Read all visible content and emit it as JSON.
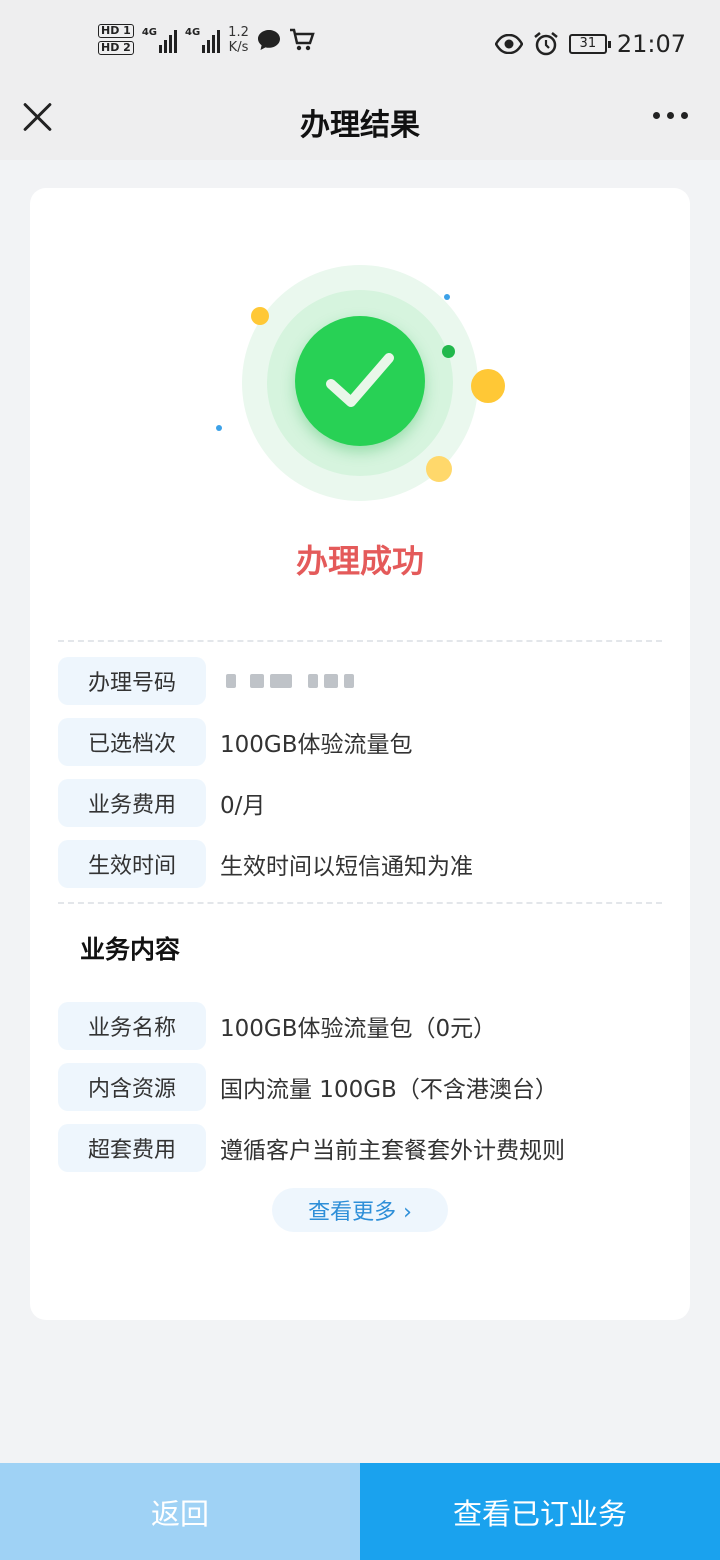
{
  "status_bar": {
    "hd1": "HD 1",
    "hd2": "HD 2",
    "net1": "4G",
    "net2": "4G",
    "speed_value": "1.2",
    "speed_unit": "K/s",
    "time": "21:07",
    "battery": "31",
    "icons": [
      "chat-icon",
      "cart-icon",
      "eye-icon",
      "alarm-icon"
    ]
  },
  "nav": {
    "title": "办理结果"
  },
  "result": {
    "status_text": "办理成功",
    "accent_color": "#28d155",
    "status_color": "#e45a5a"
  },
  "details": [
    {
      "label": "办理号码",
      "value": ""
    },
    {
      "label": "已选档次",
      "value": "100GB体验流量包"
    },
    {
      "label": "业务费用",
      "value": "0/月"
    },
    {
      "label": "生效时间",
      "value": "生效时间以短信通知为准"
    }
  ],
  "section": {
    "title": "业务内容",
    "items": [
      {
        "label": "业务名称",
        "value": "100GB体验流量包（0元）"
      },
      {
        "label": "内含资源",
        "value": "国内流量 100GB（不含港澳台）"
      },
      {
        "label": "超套费用",
        "value": "遵循客户当前主套餐套外计费规则"
      }
    ],
    "more_label": "查看更多 ›"
  },
  "bottom": {
    "back_label": "返回",
    "view_label": "查看已订业务"
  }
}
